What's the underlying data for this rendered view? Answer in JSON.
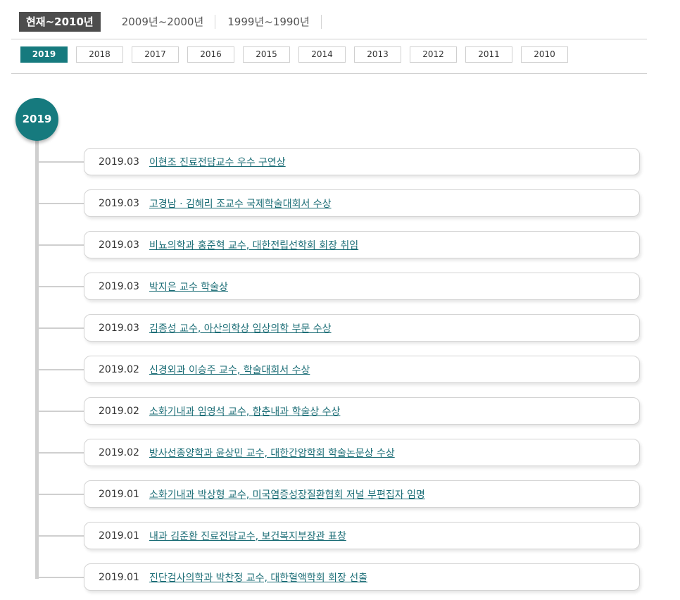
{
  "decade_tabs": [
    {
      "label": "현재~2010년",
      "active": true
    },
    {
      "label": "2009년~2000년",
      "active": false
    },
    {
      "label": "1999년~1990년",
      "active": false
    }
  ],
  "year_tabs": [
    {
      "label": "2019",
      "active": true
    },
    {
      "label": "2018",
      "active": false
    },
    {
      "label": "2017",
      "active": false
    },
    {
      "label": "2016",
      "active": false
    },
    {
      "label": "2015",
      "active": false
    },
    {
      "label": "2014",
      "active": false
    },
    {
      "label": "2013",
      "active": false
    },
    {
      "label": "2012",
      "active": false
    },
    {
      "label": "2011",
      "active": false
    },
    {
      "label": "2010",
      "active": false
    }
  ],
  "timeline": {
    "year": "2019",
    "items": [
      {
        "date": "2019.03",
        "title": "이현조 진료전담교수 우수 구연상"
      },
      {
        "date": "2019.03",
        "title": "고경남 · 김혜리 조교수 국제학술대회서 수상"
      },
      {
        "date": "2019.03",
        "title": "비뇨의학과 홍준혁 교수, 대한전립선학회 회장 취임"
      },
      {
        "date": "2019.03",
        "title": "박지은 교수 학술상"
      },
      {
        "date": "2019.03",
        "title": "김종성 교수, 아산의학상 임상의학 부문 수상"
      },
      {
        "date": "2019.02",
        "title": "신경외과 이승주 교수, 학술대회서 수상"
      },
      {
        "date": "2019.02",
        "title": "소화기내과 임영석 교수, 함춘내과 학술상 수상"
      },
      {
        "date": "2019.02",
        "title": "방사선종양학과 윤상민 교수, 대한간암학회 학술논문상 수상"
      },
      {
        "date": "2019.01",
        "title": "소화기내과 박상형 교수, 미국염증성장질환협회 저널 부편집자 임명"
      },
      {
        "date": "2019.01",
        "title": "내과 김준환 진료전담교수, 보건복지부장관 표창"
      },
      {
        "date": "2019.01",
        "title": "진단검사의학과 박찬정 교수, 대한혈액학회 회장 선출"
      }
    ]
  },
  "colors": {
    "accent": "#167a7e",
    "active_decade_bg": "#4d4d4d",
    "link": "#1b6d76",
    "line": "#cfcfcf"
  }
}
